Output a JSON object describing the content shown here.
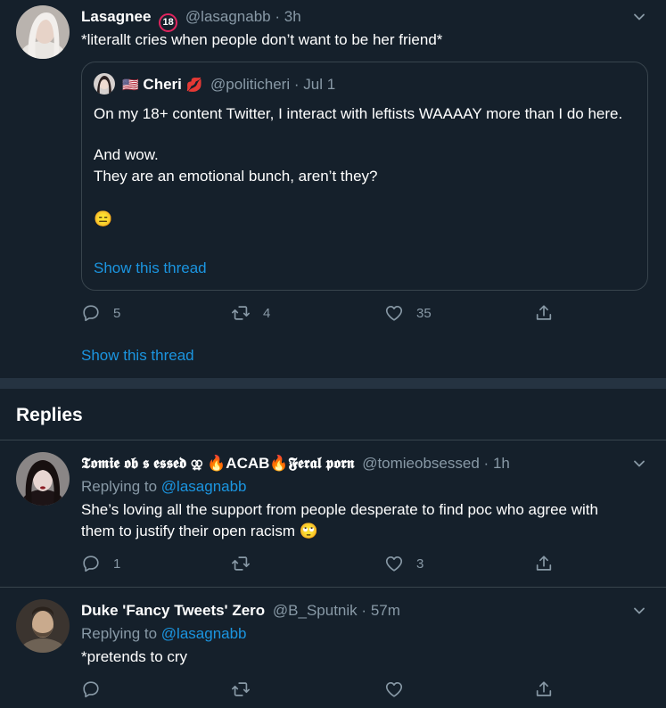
{
  "main_tweet": {
    "display_name": "Lasagnee",
    "name_badge": "18",
    "handle": "@lasagnabb",
    "separator": "·",
    "time": "3h",
    "text": "*literallt cries when people don’t want to be her friend*",
    "show_thread": "Show this thread",
    "replies_count": "5",
    "retweets_count": "4",
    "likes_count": "35"
  },
  "quoted_tweet": {
    "flag": "🇺🇸",
    "display_name": "Cheri",
    "name_emoji": "💋",
    "handle": "@politicheri",
    "separator": "·",
    "time": "Jul 1",
    "paragraph1": "On my 18+ content Twitter, I interact with leftists WAAAAY more than I do here.",
    "paragraph2_line1": "And wow.",
    "paragraph2_line2": "They are an emotional bunch, aren’t they?",
    "emoji": "😑",
    "show_thread": "Show this thread"
  },
  "replies_heading": "Replies",
  "replies": [
    {
      "display_name": "𝕿𝖔𝖒𝖎𝖊 𝖔𝖇 𝖘 𝖊𝖘𝖘𝖊𝖉 ⚢ 🔥ACAB🔥𝕱𝖊𝖗𝖆𝖑 𝖕𝖔𝖗𝖓",
      "handle": "@tomieobsessed",
      "separator": "·",
      "time": "1h",
      "replying_prefix": "Replying to",
      "replying_to": "@lasagnabb",
      "text": "She’s loving all the support from people desperate to find poc who agree with them to justify their open racism 🙄",
      "replies_count": "1",
      "retweets_count": "",
      "likes_count": "3"
    },
    {
      "display_name": "Duke 'Fancy Tweets' Zero",
      "handle": "@B_Sputnik",
      "separator": "·",
      "time": "57m",
      "replying_prefix": "Replying to",
      "replying_to": "@lasagnabb",
      "text": "*pretends to cry",
      "replies_count": "",
      "retweets_count": "",
      "likes_count": ""
    }
  ],
  "icons": {
    "reply": "reply-icon",
    "retweet": "retweet-icon",
    "like": "like-icon",
    "share": "share-icon",
    "caret": "chevron-down-icon"
  },
  "colors": {
    "background": "#15202b",
    "border": "#38444d",
    "muted": "#8899a6",
    "link": "#1b95e0"
  }
}
